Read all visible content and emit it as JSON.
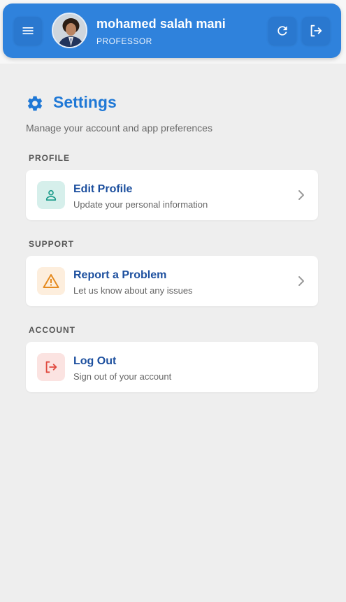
{
  "header": {
    "user_name": "mohamed salah mani",
    "user_role": "PROFESSOR",
    "menu_icon": "hamburger-menu-icon",
    "refresh_icon": "refresh-icon",
    "logout_icon": "logout-icon",
    "accent_color": "#2f82dc"
  },
  "page": {
    "title": "Settings",
    "subtitle": "Manage your account and app preferences",
    "title_icon": "gear-icon",
    "title_color": "#1f78d6"
  },
  "sections": [
    {
      "label": "PROFILE",
      "item": {
        "title": "Edit Profile",
        "description": "Update your personal information",
        "icon": "person-icon",
        "icon_color": "#1a9b8a",
        "icon_bg": "#d6efeb",
        "has_chevron": true
      }
    },
    {
      "label": "SUPPORT",
      "item": {
        "title": "Report a Problem",
        "description": "Let us know about any issues",
        "icon": "warning-icon",
        "icon_color": "#e58a1f",
        "icon_bg": "#fdeedd",
        "has_chevron": true
      }
    },
    {
      "label": "ACCOUNT",
      "item": {
        "title": "Log Out",
        "description": "Sign out of your account",
        "icon": "logout-icon",
        "icon_color": "#e04a3f",
        "icon_bg": "#fbe3e1",
        "has_chevron": false
      }
    }
  ]
}
